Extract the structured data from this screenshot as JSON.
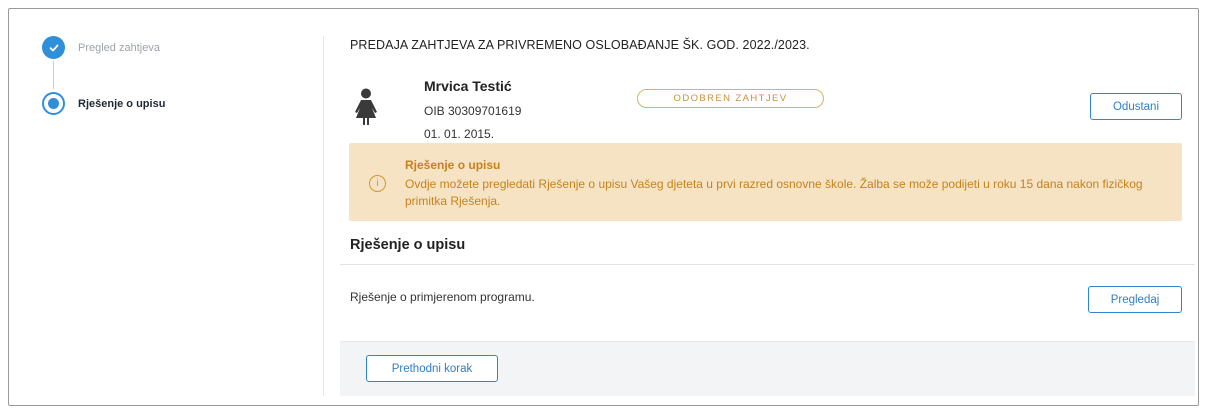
{
  "stepper": {
    "steps": [
      {
        "label": "Pregled zahtjeva",
        "state": "done"
      },
      {
        "label": "Rješenje o upisu",
        "state": "current"
      }
    ]
  },
  "header": {
    "title": "PREDAJA ZAHTJEVA ZA PRIVREMENO OSLOBAĐANJE ŠK. GOD. 2022./2023."
  },
  "child": {
    "name": "Mrvica Testić",
    "oib": "OIB 30309701619",
    "dob": "01. 01. 2015.",
    "icon": "child-icon"
  },
  "status": {
    "label": "ODOBREN ZAHTJEV",
    "color": "#d7b06a"
  },
  "actions": {
    "cancel_label": "Odustani",
    "view_label": "Pregledaj",
    "prev_label": "Prethodni korak"
  },
  "notice": {
    "title": "Rješenje o upisu",
    "text": "Ovdje možete pregledati Rješenje o upisu Vašeg djeteta u prvi razred osnovne škole. Žalba se može podijeti u roku 15 dana nakon fizičkog primitka Rješenja.",
    "icon": "info-icon",
    "background": "#f6e3c3",
    "text_color": "#c7821d"
  },
  "section": {
    "title": "Rješenje o upisu",
    "item_text": "Rješenje o primjerenom programu."
  },
  "colors": {
    "accent": "#2f8fd8"
  }
}
